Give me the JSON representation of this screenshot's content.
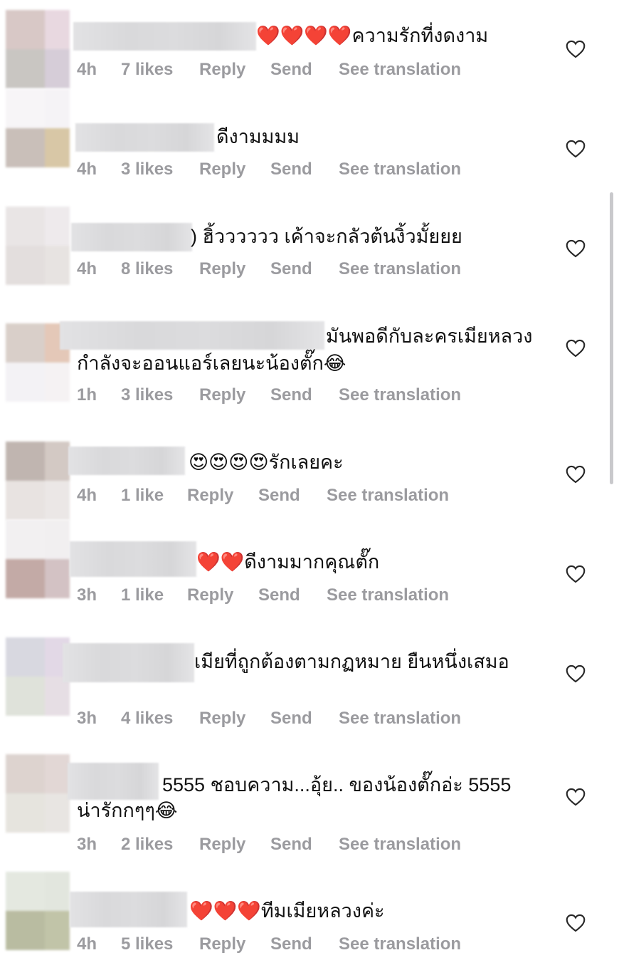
{
  "like_icon": "heart-outline-icon",
  "colors": {
    "text": "#111111",
    "meta": "#9b9b9f",
    "scrollbar": "#c9c9cc"
  },
  "comments": [
    {
      "text": "❤️❤️❤️❤️ความรักที่งดงาม",
      "time": "4h",
      "likes": "7 likes",
      "reply": "Reply",
      "send": "Send",
      "translate": "See translation",
      "avatar_colors": [
        "#d8c8c6",
        "#e8d8e0",
        "#c9c6c2",
        "#d6cdd8"
      ]
    },
    {
      "text": "ดีงามมมม",
      "time": "4h",
      "likes": "3 likes",
      "reply": "Reply",
      "send": "Send",
      "translate": "See translation",
      "avatar_colors": [
        "#f7f5f7",
        "#f5f3f6",
        "#c9bfb9",
        "#d8c7a6"
      ]
    },
    {
      "text": ") ฮิ้วววววว เค้าจะกลัวต้นงิ้วมั้ยยย",
      "time": "4h",
      "likes": "8 likes",
      "reply": "Reply",
      "send": "Send",
      "translate": "See translation",
      "avatar_colors": [
        "#e9e5e5",
        "#eeeaec",
        "#e3dedd",
        "#e7e3e1"
      ]
    },
    {
      "text": "มันพอดีกับละครเมียหลวง",
      "text2": "กำลังจะออนแอร์เลยนะน้องตั๊ก😂",
      "time": "1h",
      "likes": "3 likes",
      "reply": "Reply",
      "send": "Send",
      "translate": "See translation",
      "avatar_colors": [
        "#d9cfc9",
        "#e4c8b8",
        "#f3f2f5",
        "#f5f2f3"
      ]
    },
    {
      "text": "😍😍😍😍รักเลยคะ",
      "time": "4h",
      "likes": "1 like",
      "reply": "Reply",
      "send": "Send",
      "translate": "See translation",
      "avatar_colors": [
        "#c0b5b0",
        "#d3c9c4",
        "#e8e3e1",
        "#ebe7e6"
      ]
    },
    {
      "text": "❤️❤️ดีงามมากคุณตั๊ก",
      "time": "3h",
      "likes": "1 like",
      "reply": "Reply",
      "send": "Send",
      "translate": "See translation",
      "avatar_colors": [
        "#f2f0f1",
        "#f1eff0",
        "#c3aaa6",
        "#d3c2c4"
      ]
    },
    {
      "text": "เมียที่ถูกต้องตามกฏหมาย ยืนหนึ่งเสมอ",
      "time": "3h",
      "likes": "4 likes",
      "reply": "Reply",
      "send": "Send",
      "translate": "See translation",
      "avatar_colors": [
        "#d8d8e0",
        "#e2d8e6",
        "#dfe2da",
        "#e6dee4"
      ]
    },
    {
      "text": "5555 ชอบความ...อุ้ย.. ของน้องตั๊กอ่ะ 5555",
      "text2": "น่ารักกๆๆ😂",
      "time": "3h",
      "likes": "2 likes",
      "reply": "Reply",
      "send": "Send",
      "translate": "See translation",
      "avatar_colors": [
        "#ddd3cf",
        "#e2d7d5",
        "#e6e4de",
        "#e8e5e2"
      ]
    },
    {
      "text": "❤️❤️❤️ทีมเมียหลวงค่ะ",
      "time": "4h",
      "likes": "5 likes",
      "reply": "Reply",
      "send": "Send",
      "translate": "See translation",
      "avatar_colors": [
        "#e4e8e0",
        "#e2e6de",
        "#b9bca1",
        "#c1c4a8"
      ]
    }
  ]
}
